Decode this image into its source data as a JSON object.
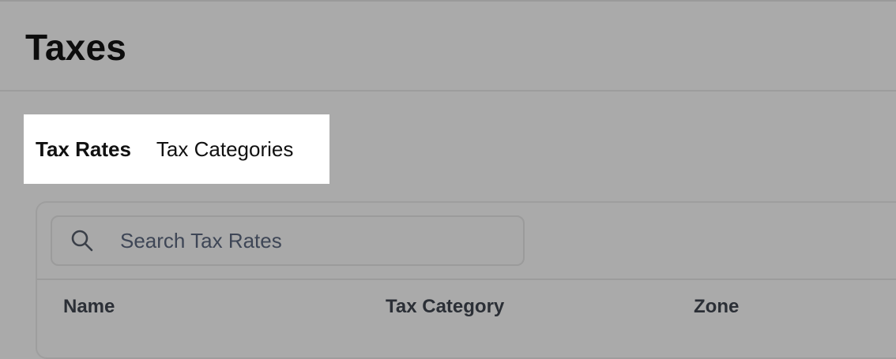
{
  "page": {
    "title": "Taxes"
  },
  "tabs": [
    {
      "label": "Tax Rates",
      "active": true
    },
    {
      "label": "Tax Categories",
      "active": false
    }
  ],
  "search": {
    "placeholder": "Search Tax Rates",
    "value": "",
    "icon": "search-icon"
  },
  "table": {
    "columns": [
      "Name",
      "Tax Category",
      "Zone"
    ]
  },
  "colors": {
    "background": "#aaaaaa",
    "tabs_background": "#ffffff",
    "text": "#111111"
  }
}
